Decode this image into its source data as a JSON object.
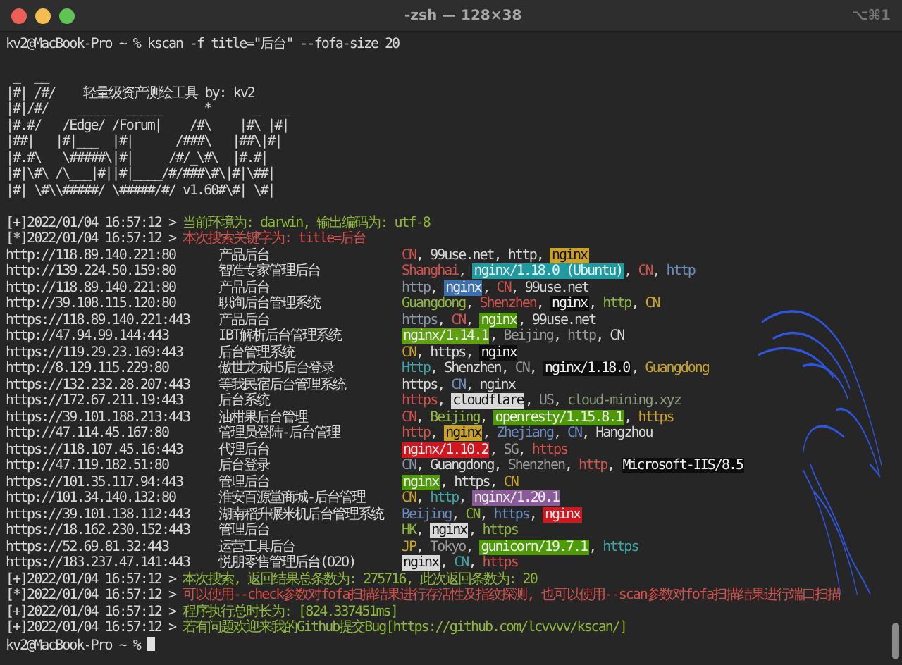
{
  "window": {
    "title": "-zsh — 128×38",
    "shortcut": "⌥⌘1"
  },
  "command": "kv2@MacBook-Pro ~ % kscan -f title=\"后台\" --fofa-size 20",
  "banner": [
    " _  __",
    "|#| /#/    轻量级资产测绘工具 by: kv2",
    "|#|/#/    _____  _____      *      _   _",
    "|#.#/   /Edge/ /Forum|    /#\\    |#\\ |#|",
    "|##|   |#|___  |#|      /###\\   |##\\|#|",
    "|#.#\\   \\#####\\|#|     /#/_\\#\\  |#.#|",
    "|#|\\#\\ /\\___|#||#|____/#/###\\#\\|#|\\##|",
    "|#| \\#\\\\#####/ \\#####/#/ v1.60#\\#| \\#|"
  ],
  "log_start": [
    {
      "prefix": "[+]2022/01/04 16:57:12 > ",
      "message": "当前环境为: darwin, 输出编码为: utf-8",
      "color": "#8fb83a"
    },
    {
      "prefix": "[*]2022/01/04 16:57:12 > ",
      "message": "本次搜索关键字为: title=后台",
      "color": "#d2514c"
    }
  ],
  "results": {
    "separator": ", ",
    "rows": [
      {
        "url": "http://118.89.140.221:80",
        "title": "产品后台",
        "tags": [
          {
            "text": "CN",
            "kind": "text",
            "color": "#d2514c"
          },
          {
            "text": "99use.net",
            "kind": "text",
            "color": "#d8d8d8"
          },
          {
            "text": "http",
            "kind": "text",
            "color": "#d8d8d8"
          },
          {
            "text": "nginx",
            "kind": "badge",
            "color": "#c9a227"
          }
        ]
      },
      {
        "url": "http://139.224.50.159:80",
        "title": "智造专家管理后台",
        "tags": [
          {
            "text": "Shanghai",
            "kind": "text",
            "color": "#d2514c"
          },
          {
            "text": "nginx/1.18.0 (Ubuntu)",
            "kind": "badge",
            "color": "#1f9aa0"
          },
          {
            "text": "CN",
            "kind": "text",
            "color": "#d2514c"
          },
          {
            "text": "http",
            "kind": "text",
            "color": "#6b8cc0"
          }
        ]
      },
      {
        "url": "http://118.89.140.221:80",
        "title": "产品后台",
        "tags": [
          {
            "text": "http",
            "kind": "text",
            "color": "#8a96aa"
          },
          {
            "text": "nginx",
            "kind": "badge",
            "color": "#3a6fb0"
          },
          {
            "text": "CN",
            "kind": "text",
            "color": "#d2514c"
          },
          {
            "text": "99use.net",
            "kind": "text",
            "color": "#d8d8d8"
          }
        ]
      },
      {
        "url": "http://39.108.115.120:80",
        "title": "职询后台管理系统",
        "tags": [
          {
            "text": "Guangdong",
            "kind": "text",
            "color": "#8fb83a"
          },
          {
            "text": "Shenzhen",
            "kind": "text",
            "color": "#d2514c"
          },
          {
            "text": "nginx",
            "kind": "badge",
            "color": "#0e0e0e"
          },
          {
            "text": "http",
            "kind": "text",
            "color": "#8fb83a"
          },
          {
            "text": "CN",
            "kind": "text",
            "color": "#c9a227"
          }
        ]
      },
      {
        "url": "https://118.89.140.221:443",
        "title": "产品后台",
        "tags": [
          {
            "text": "https",
            "kind": "text",
            "color": "#8a96aa"
          },
          {
            "text": "CN",
            "kind": "text",
            "color": "#d2514c"
          },
          {
            "text": "nginx",
            "kind": "badge",
            "color": "#4e9a06"
          },
          {
            "text": "99use.net",
            "kind": "text",
            "color": "#d8d8d8"
          }
        ]
      },
      {
        "url": "http://47.94.99.144:443",
        "title": "IBT解析后台管理系统",
        "tags": [
          {
            "text": "nginx/1.14.1",
            "kind": "badge",
            "color": "#5fa010"
          },
          {
            "text": "Beijing",
            "kind": "text",
            "color": "#9a9a9a"
          },
          {
            "text": "http",
            "kind": "text",
            "color": "#9a9a9a"
          },
          {
            "text": "CN",
            "kind": "text",
            "color": "#d8d8d8"
          }
        ]
      },
      {
        "url": "https://119.29.23.169:443",
        "title": "后台管理系统",
        "tags": [
          {
            "text": "CN",
            "kind": "text",
            "color": "#c9a227"
          },
          {
            "text": "https",
            "kind": "text",
            "color": "#d8d8d8"
          },
          {
            "text": "nginx",
            "kind": "badge",
            "color": "#0e0e0e"
          }
        ]
      },
      {
        "url": "http://8.129.115.229:80",
        "title": "傲世龙城H5后台登录",
        "tags": [
          {
            "text": "Http",
            "kind": "text",
            "color": "#3fa6a6"
          },
          {
            "text": "Shenzhen",
            "kind": "text",
            "color": "#d8d8d8"
          },
          {
            "text": "CN",
            "kind": "text",
            "color": "#9a9a9a"
          },
          {
            "text": "nginx/1.18.0",
            "kind": "badge",
            "color": "#0e0e0e"
          },
          {
            "text": "Guangdong",
            "kind": "text",
            "color": "#c9a227"
          }
        ]
      },
      {
        "url": "https://132.232.28.207:443",
        "title": "等我民宿后台管理系统",
        "tags": [
          {
            "text": "https",
            "kind": "text",
            "color": "#d8d8d8"
          },
          {
            "text": "CN",
            "kind": "text",
            "color": "#6b8cc0"
          },
          {
            "text": "nginx",
            "kind": "text",
            "color": "#d8d8d8"
          }
        ]
      },
      {
        "url": "https://172.67.211.19:443",
        "title": "后台系统",
        "tags": [
          {
            "text": "https",
            "kind": "text",
            "color": "#d2514c"
          },
          {
            "text": "cloudflare",
            "kind": "badge",
            "color": "#d8d8d8"
          },
          {
            "text": "US",
            "kind": "text",
            "color": "#9a9a9a"
          },
          {
            "text": "cloud-mining.xyz",
            "kind": "text",
            "color": "#8a9a7a"
          }
        ]
      },
      {
        "url": "https://39.101.188.213:443",
        "title": "油柑果后台管理",
        "tags": [
          {
            "text": "CN",
            "kind": "text",
            "color": "#d2514c"
          },
          {
            "text": "Beijing",
            "kind": "text",
            "color": "#8fb83a"
          },
          {
            "text": "openresty/1.15.8.1",
            "kind": "badge",
            "color": "#4e9a06"
          },
          {
            "text": "https",
            "kind": "text",
            "color": "#c9a227"
          }
        ]
      },
      {
        "url": "http://47.114.45.167:80",
        "title": "管理员登陆-后台管理",
        "tags": [
          {
            "text": "http",
            "kind": "text",
            "color": "#d2514c"
          },
          {
            "text": "nginx",
            "kind": "badge",
            "color": "#c9a227"
          },
          {
            "text": "Zhejiang",
            "kind": "text",
            "color": "#6b8cc0"
          },
          {
            "text": "CN",
            "kind": "text",
            "color": "#6b8cc0"
          },
          {
            "text": "Hangzhou",
            "kind": "text",
            "color": "#d8d8d8"
          }
        ]
      },
      {
        "url": "https://118.107.45.16:443",
        "title": "代理后台",
        "tags": [
          {
            "text": "nginx/1.10.2",
            "kind": "badge",
            "color": "#d0161e"
          },
          {
            "text": "SG",
            "kind": "text",
            "color": "#9a9a9a"
          },
          {
            "text": "https",
            "kind": "text",
            "color": "#d2514c"
          }
        ]
      },
      {
        "url": "http://47.119.182.51:80",
        "title": "后台登录",
        "tags": [
          {
            "text": "CN",
            "kind": "text",
            "color": "#8a96aa"
          },
          {
            "text": "Guangdong",
            "kind": "text",
            "color": "#d8d8d8"
          },
          {
            "text": "Shenzhen",
            "kind": "text",
            "color": "#9a9a9a"
          },
          {
            "text": "http",
            "kind": "text",
            "color": "#d2514c"
          },
          {
            "text": "Microsoft-IIS/8.5",
            "kind": "badge",
            "color": "#0e0e0e"
          }
        ]
      },
      {
        "url": "https://101.35.117.94:443",
        "title": "管理后台",
        "tags": [
          {
            "text": "nginx",
            "kind": "badge",
            "color": "#4e9a06"
          },
          {
            "text": "https",
            "kind": "text",
            "color": "#d8d8d8"
          },
          {
            "text": "CN",
            "kind": "text",
            "color": "#c9a227"
          }
        ]
      },
      {
        "url": "http://101.34.140.132:80",
        "title": "淮安百源堂商城-后台管理",
        "tags": [
          {
            "text": "CN",
            "kind": "text",
            "color": "#c9a227"
          },
          {
            "text": "http",
            "kind": "text",
            "color": "#3fa6a6"
          },
          {
            "text": "nginx/1.20.1",
            "kind": "badge",
            "color": "#8a5a9a"
          }
        ]
      },
      {
        "url": "https://39.101.138.112:443",
        "title": "湖南稻升碾米机后台管理系统",
        "tags": [
          {
            "text": "Beijing",
            "kind": "text",
            "color": "#6b8cc0"
          },
          {
            "text": "CN",
            "kind": "text",
            "color": "#8fb83a"
          },
          {
            "text": "https",
            "kind": "text",
            "color": "#6b8cc0"
          },
          {
            "text": "nginx",
            "kind": "badge",
            "color": "#d0161e"
          }
        ]
      },
      {
        "url": "https://18.162.230.152:443",
        "title": "管理后台",
        "tags": [
          {
            "text": "HK",
            "kind": "text",
            "color": "#8fb83a"
          },
          {
            "text": "nginx",
            "kind": "badge",
            "color": "#d8d8d8"
          },
          {
            "text": "https",
            "kind": "text",
            "color": "#8fb83a"
          }
        ]
      },
      {
        "url": "https://52.69.81.32:443",
        "title": "运营工具后台",
        "tags": [
          {
            "text": "JP",
            "kind": "text",
            "color": "#c9a227"
          },
          {
            "text": "Tokyo",
            "kind": "text",
            "color": "#9a9a9a"
          },
          {
            "text": "gunicorn/19.7.1",
            "kind": "badge",
            "color": "#4e9a06"
          },
          {
            "text": "https",
            "kind": "text",
            "color": "#3fa6a6"
          }
        ]
      },
      {
        "url": "https://183.237.47.141:443",
        "title": "悦朋零售管理后台(O2O)",
        "tags": [
          {
            "text": "nginx",
            "kind": "badge",
            "color": "#d8d8d8"
          },
          {
            "text": "CN",
            "kind": "text",
            "color": "#3fa6a6"
          },
          {
            "text": "https",
            "kind": "text",
            "color": "#d2514c"
          }
        ]
      }
    ]
  },
  "log_end": [
    {
      "prefix": "[+]2022/01/04 16:57:12 > ",
      "message": "本次搜索, 返回结果总条数为: 275716, 此次返回条数为: 20",
      "color": "#8fb83a"
    },
    {
      "prefix": "[*]2022/01/04 16:57:12 > ",
      "message": "可以使用--check参数对fofa扫描结果进行存活性及指纹探测, 也可以使用--scan参数对fofa扫描结果进行端口扫描",
      "color": "#d2514c"
    },
    {
      "prefix": "[+]2022/01/04 16:57:12 > ",
      "message": "程序执行总时长为: [824.337451ms]",
      "color": "#8fb83a"
    },
    {
      "prefix": "[+]2022/01/04 16:57:12 > ",
      "message": "若有问题欢迎来我的Github提交Bug[https://github.com/lcvvvv/kscan/]",
      "color": "#8fb83a"
    }
  ],
  "prompt": "kv2@MacBook-Pro ~ % "
}
